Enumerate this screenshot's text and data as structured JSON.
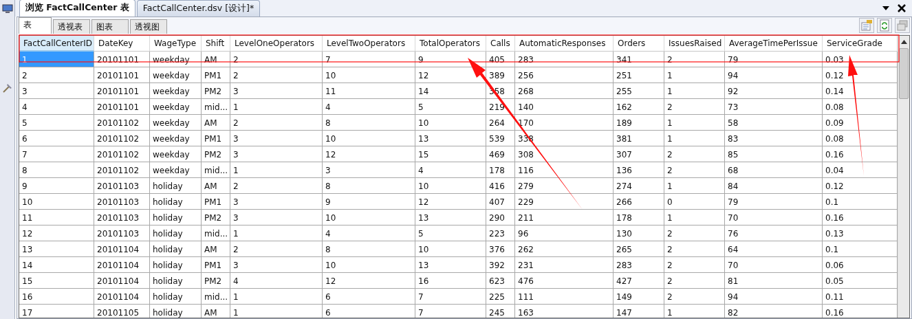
{
  "doc_tabs": [
    {
      "label": "浏览 FactCallCenter 表",
      "selected": true
    },
    {
      "label": "FactCallCenter.dsv [设计]*",
      "selected": false
    }
  ],
  "view_tabs": [
    {
      "label": "表",
      "selected": true
    },
    {
      "label": "透视表",
      "selected": false
    },
    {
      "label": "图表",
      "selected": false
    },
    {
      "label": "透视图",
      "selected": false
    }
  ],
  "table": {
    "columns": [
      "FactCallCenterID",
      "DateKey",
      "WageType",
      "Shift",
      "LevelOneOperators",
      "LevelTwoOperators",
      "TotalOperators",
      "Calls",
      "AutomaticResponses",
      "Orders",
      "IssuesRaised",
      "AverageTimePerIssue",
      "ServiceGrade"
    ],
    "rows": [
      {
        "selected": true,
        "cells": [
          "1",
          "20101101",
          "weekday",
          "AM",
          "2",
          "7",
          "9",
          "405",
          "283",
          "341",
          "2",
          "79",
          "0.03"
        ]
      },
      {
        "selected": false,
        "cells": [
          "2",
          "20101101",
          "weekday",
          "PM1",
          "2",
          "10",
          "12",
          "389",
          "256",
          "251",
          "1",
          "94",
          "0.12"
        ]
      },
      {
        "selected": false,
        "cells": [
          "3",
          "20101101",
          "weekday",
          "PM2",
          "3",
          "11",
          "14",
          "358",
          "268",
          "255",
          "1",
          "92",
          "0.14"
        ]
      },
      {
        "selected": false,
        "cells": [
          "4",
          "20101101",
          "weekday",
          "mid...",
          "1",
          "4",
          "5",
          "219",
          "140",
          "162",
          "2",
          "73",
          "0.08"
        ]
      },
      {
        "selected": false,
        "cells": [
          "5",
          "20101102",
          "weekday",
          "AM",
          "2",
          "8",
          "10",
          "264",
          "170",
          "189",
          "1",
          "58",
          "0.09"
        ]
      },
      {
        "selected": false,
        "cells": [
          "6",
          "20101102",
          "weekday",
          "PM1",
          "3",
          "10",
          "13",
          "539",
          "338",
          "381",
          "1",
          "83",
          "0.08"
        ]
      },
      {
        "selected": false,
        "cells": [
          "7",
          "20101102",
          "weekday",
          "PM2",
          "3",
          "12",
          "15",
          "469",
          "308",
          "307",
          "2",
          "85",
          "0.16"
        ]
      },
      {
        "selected": false,
        "cells": [
          "8",
          "20101102",
          "weekday",
          "mid...",
          "1",
          "3",
          "4",
          "178",
          "116",
          "136",
          "2",
          "68",
          "0.04"
        ]
      },
      {
        "selected": false,
        "cells": [
          "9",
          "20101103",
          "holiday",
          "AM",
          "2",
          "8",
          "10",
          "416",
          "279",
          "274",
          "1",
          "84",
          "0.12"
        ]
      },
      {
        "selected": false,
        "cells": [
          "10",
          "20101103",
          "holiday",
          "PM1",
          "3",
          "9",
          "12",
          "407",
          "229",
          "266",
          "0",
          "79",
          "0.1"
        ]
      },
      {
        "selected": false,
        "cells": [
          "11",
          "20101103",
          "holiday",
          "PM2",
          "3",
          "10",
          "13",
          "290",
          "211",
          "178",
          "1",
          "70",
          "0.16"
        ]
      },
      {
        "selected": false,
        "cells": [
          "12",
          "20101103",
          "holiday",
          "mid...",
          "1",
          "4",
          "5",
          "223",
          "96",
          "130",
          "2",
          "76",
          "0.13"
        ]
      },
      {
        "selected": false,
        "cells": [
          "13",
          "20101104",
          "holiday",
          "AM",
          "2",
          "8",
          "10",
          "376",
          "262",
          "265",
          "2",
          "64",
          "0.1"
        ]
      },
      {
        "selected": false,
        "cells": [
          "14",
          "20101104",
          "holiday",
          "PM1",
          "3",
          "10",
          "13",
          "392",
          "231",
          "283",
          "2",
          "70",
          "0.06"
        ]
      },
      {
        "selected": false,
        "cells": [
          "15",
          "20101104",
          "holiday",
          "PM2",
          "4",
          "12",
          "16",
          "623",
          "476",
          "427",
          "2",
          "81",
          "0.05"
        ]
      },
      {
        "selected": false,
        "cells": [
          "16",
          "20101104",
          "holiday",
          "mid...",
          "1",
          "6",
          "7",
          "225",
          "111",
          "149",
          "2",
          "94",
          "0.11"
        ]
      },
      {
        "selected": false,
        "cells": [
          "17",
          "20101105",
          "holiday",
          "AM",
          "1",
          "6",
          "7",
          "245",
          "163",
          "147",
          "1",
          "82",
          "0.16"
        ]
      }
    ]
  }
}
